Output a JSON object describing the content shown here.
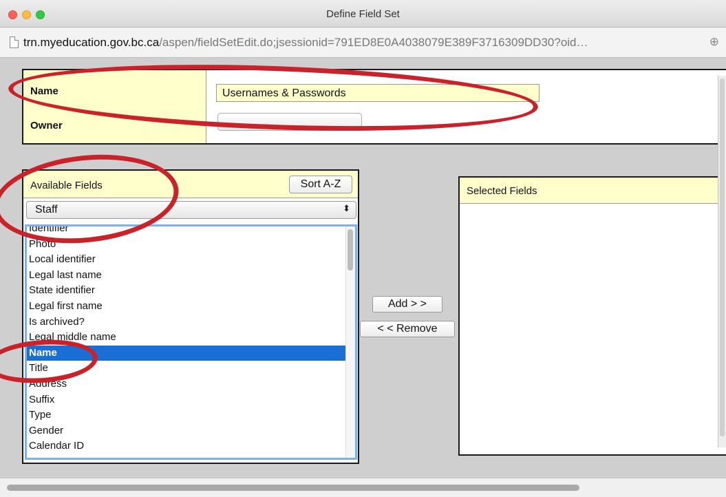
{
  "window": {
    "title": "Define Field Set"
  },
  "address_bar": {
    "host": "trn.myeducation.gov.bc.ca",
    "path": "/aspen/fieldSetEdit.do;jsessionid=791ED8E0A4038079E389F3716309DD30?oid…",
    "icons": [
      "page-icon",
      "zoom-icon"
    ]
  },
  "field_set": {
    "name_label": "Name",
    "name_value": "Usernames & Passwords",
    "owner_label": "Owner",
    "owner_value": ""
  },
  "available": {
    "title": "Available Fields",
    "sort_label": "Sort A-Z",
    "table_select": "Staff",
    "items": [
      "Identifier",
      "Photo",
      "Local identifier",
      "Legal last name",
      "State identifier",
      "Legal first name",
      "Is archived?",
      "Legal middle name",
      "Name",
      "Title",
      "Address",
      "Suffix",
      "Type",
      "Gender",
      "Calendar ID"
    ],
    "selected_item": "Name"
  },
  "buttons": {
    "add": "Add > >",
    "remove": "< < Remove"
  },
  "selected": {
    "title": "Selected Fields"
  },
  "annotation_color": "#c8232a",
  "selection_color": "#1a6fd6",
  "header_color": "#ffffcc"
}
